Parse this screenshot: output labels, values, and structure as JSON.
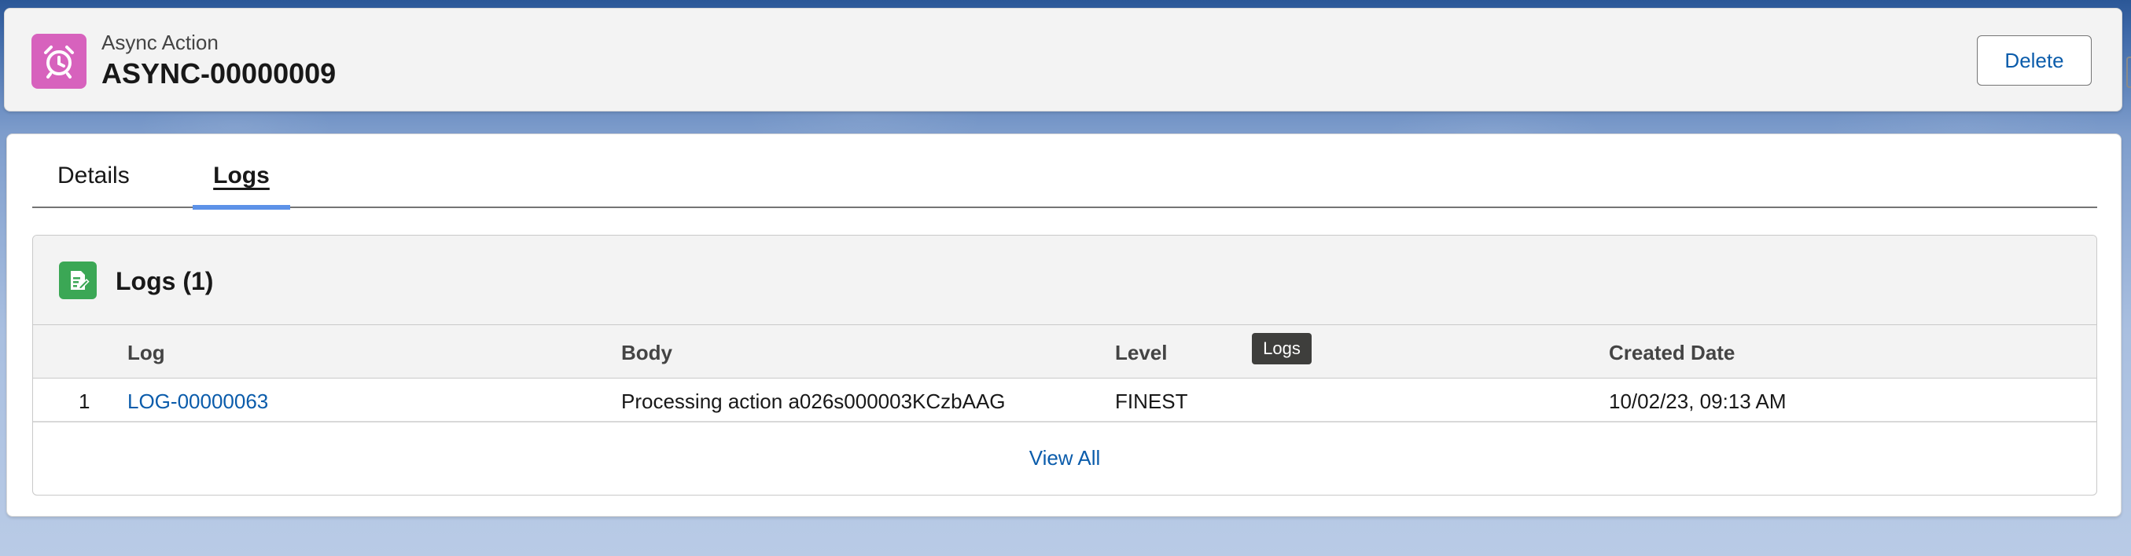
{
  "header": {
    "record_type": "Async Action",
    "record_name": "ASYNC-00000009",
    "delete_label": "Delete",
    "icon": "alarm-clock-icon",
    "icon_color": "#d762bd"
  },
  "tabs": [
    {
      "label": "Details",
      "active": false
    },
    {
      "label": "Logs",
      "active": true
    }
  ],
  "related_list": {
    "title": "Logs (1)",
    "icon": "log-document-icon",
    "icon_color": "#3ba755",
    "columns": [
      "Log",
      "Body",
      "Level",
      "Created Date"
    ],
    "rows": [
      {
        "num": "1",
        "log": "LOG-00000063",
        "body": "Processing action a026s000003KCzbAAG",
        "level": "FINEST",
        "created_date": "10/02/23, 09:13 AM"
      }
    ],
    "view_all_label": "View All"
  },
  "tooltip": {
    "text": "Logs"
  },
  "colors": {
    "link": "#0b5cab",
    "active_tab_indicator": "#5d92e8"
  }
}
